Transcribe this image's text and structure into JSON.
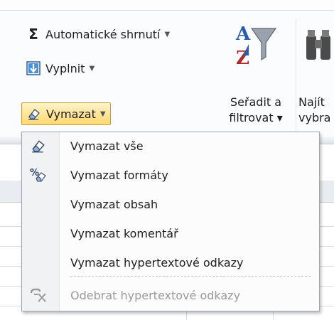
{
  "ribbon": {
    "autosum": {
      "label": "Automatické shrnutí",
      "icon": "sigma-icon"
    },
    "fill": {
      "label": "Vyplnit",
      "icon": "fill-down-icon"
    },
    "clear": {
      "label": "Vymazat",
      "icon": "eraser-icon"
    },
    "sort_filter": {
      "line1": "Seřadit a",
      "line2": "filtrovat ▾",
      "icon": "sort-filter-icon"
    },
    "find_select": {
      "line1": "Najít",
      "line2": "vybra",
      "icon": "binoculars-icon"
    }
  },
  "menu": {
    "items": [
      {
        "label": "Vymazat vše",
        "icon": "eraser-icon",
        "enabled": true
      },
      {
        "label": "Vymazat formáty",
        "icon": "clear-formats-icon",
        "enabled": true
      },
      {
        "label": "Vymazat obsah",
        "icon": "",
        "enabled": true
      },
      {
        "label": "Vymazat komentář",
        "icon": "",
        "enabled": true
      },
      {
        "label": "Vymazat hypertextové odkazy",
        "icon": "",
        "enabled": true
      },
      {
        "label": "Odebrat hypertextové odkazy",
        "icon": "remove-hyperlinks-icon",
        "enabled": false
      }
    ]
  },
  "colors": {
    "highlight": "#ffd870",
    "disabled_text": "#9a9a9a",
    "accent": "#2b74c7"
  }
}
